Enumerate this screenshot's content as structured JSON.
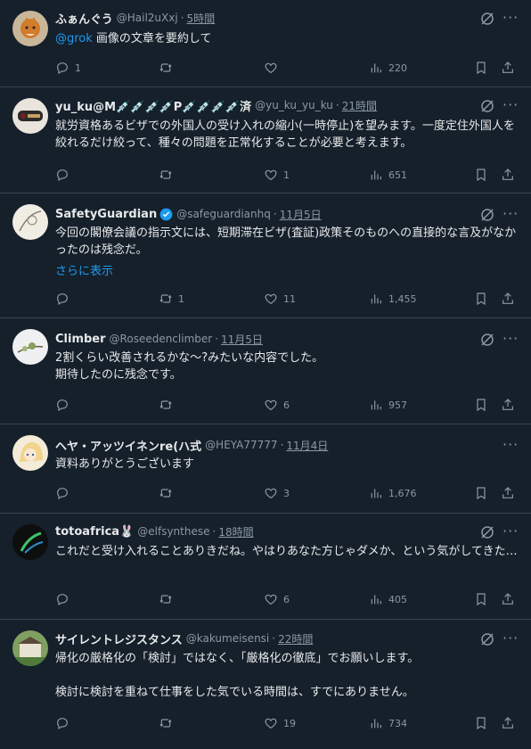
{
  "tweets": [
    {
      "name": "ふぁんぐう",
      "handle": "@Hail2uXxj",
      "time": "5時間",
      "mention": "@grok",
      "text": " 画像の文章を要約して",
      "replies": "1",
      "retweets": "",
      "likes": "",
      "views": "220"
    },
    {
      "name": "yu_ku@M💉💉💉💉P💉💉💉💉済",
      "handle": "@yu_ku_yu_ku",
      "time": "21時間",
      "text": "就労資格あるビザでの外国人の受け入れの縮小(一時停止)を望みます。一度定住外国人を絞れるだけ絞って、種々の問題を正常化することが必要と考えます。",
      "replies": "",
      "retweets": "",
      "likes": "1",
      "views": "651"
    },
    {
      "name": "SafetyGuardian",
      "handle": "@safeguardianhq",
      "time": "11月5日",
      "text": "今回の閣僚会議の指示文には、短期滞在ビザ(査証)政策そのものへの直接的な言及がなかったのは残念だ。",
      "show_more": "さらに表示",
      "replies": "",
      "retweets": "1",
      "likes": "11",
      "views": "1,455"
    },
    {
      "name": "Climber",
      "handle": "@Roseedenclimber",
      "time": "11月5日",
      "text": "2割くらい改善されるかな〜?みたいな内容でした。\n期待したのに残念です。",
      "replies": "",
      "retweets": "",
      "likes": "6",
      "views": "957"
    },
    {
      "name": "ヘヤ・アッツイネンre(ハ式",
      "handle": "@HEYA77777",
      "time": "11月4日",
      "text": "資料ありがとうございます",
      "replies": "",
      "retweets": "",
      "likes": "3",
      "views": "1,676"
    },
    {
      "name": "totoafrica🐰",
      "handle": "@elfsynthese",
      "time": "18時間",
      "text": "これだと受け入れることありきだね。やはりあなた方じゃダメか、という気がしてきた…",
      "replies": "",
      "retweets": "",
      "likes": "6",
      "views": "405"
    },
    {
      "name": "サイレントレジスタンス",
      "handle": "@kakumeisensi",
      "time": "22時間",
      "text": "帰化の厳格化の「検討」ではなく、「厳格化の徹底」でお願いします。\n\n検討に検討を重ねて仕事をした気でいる時間は、すでにありません。",
      "replies": "",
      "retweets": "",
      "likes": "19",
      "views": "734"
    }
  ],
  "icons": {
    "reply": "reply-icon",
    "retweet": "retweet-icon",
    "like": "heart-icon",
    "views": "views-icon",
    "bookmark": "bookmark-icon",
    "share": "share-icon",
    "grok": "grok-icon",
    "more": "more-icon",
    "verified": "verified-badge-icon"
  },
  "colors": {
    "background": "#15202b",
    "text": "#e7e9ea",
    "secondary": "#8b98a5",
    "link": "#1d9bf0",
    "divider": "#38444d"
  }
}
